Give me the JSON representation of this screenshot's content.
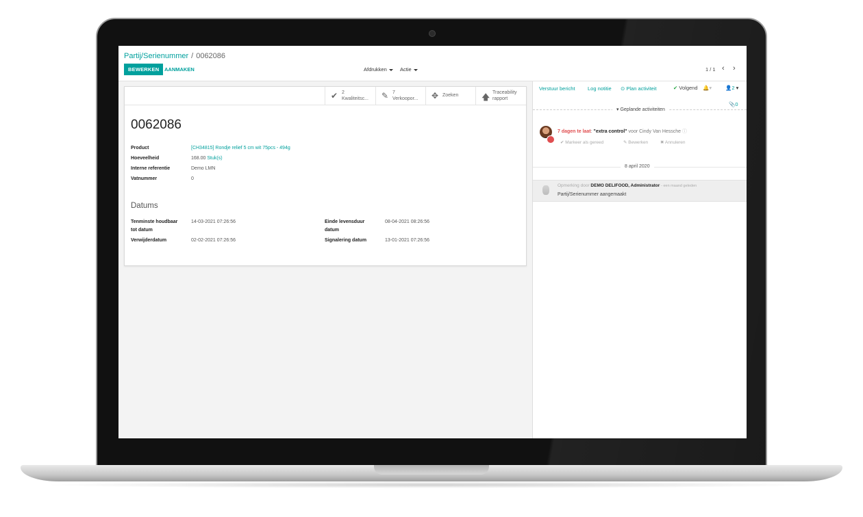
{
  "breadcrumb": {
    "parent": "Partij/Serienummer",
    "separator": "/",
    "current": "0062086"
  },
  "toolbar": {
    "edit_label": "BEWERKEN",
    "create_label": "AANMAKEN",
    "print_label": "Afdrukken",
    "action_label": "Actie"
  },
  "pager": {
    "value": "1 / 1",
    "prev": "‹",
    "next": "›"
  },
  "stat_buttons": [
    {
      "icon": "check-icon",
      "count": "2",
      "label": "Kwaliteitsc..."
    },
    {
      "icon": "edit-icon",
      "count": "7",
      "label": "Verkoopor..."
    },
    {
      "icon": "move-icon",
      "count": "",
      "label": "Zoeken"
    },
    {
      "icon": "arrow-up-icon",
      "count": "Traceability",
      "label": "rapport"
    }
  ],
  "record": {
    "title": "0062086"
  },
  "fields": [
    {
      "label": "Product",
      "value": "[CH34815] Rondje relief 5 cm wit 75pcs - 494g"
    },
    {
      "label": "Hoeveelheid",
      "value": "168.00",
      "unit": "Stuk(s)"
    },
    {
      "label": "Interne referentie",
      "value": "Demo LMN"
    },
    {
      "label": "Vatnummer",
      "value": "0"
    }
  ],
  "dates": {
    "title": "Datums",
    "items": [
      {
        "label_1": "Tenminste houdbaar",
        "label_2": "tot datum",
        "value": "14-03-2021 07:26:56"
      },
      {
        "label_1": "Verwijderdatum",
        "label_2": "",
        "value": "02-02-2021 07:26:56"
      },
      {
        "label_1": "Einde levensduur",
        "label_2": "datum",
        "value": "08-04-2021 08:26:56"
      },
      {
        "label_1": "Signalering datum",
        "label_2": "",
        "value": "13-01-2021 07:26:56"
      }
    ]
  },
  "chatter": {
    "send_message": "Verstuur bericht",
    "log_note": "Log notitie",
    "plan_activity": "Plan activiteit",
    "following": "Volgend",
    "followers_count": "2",
    "attachments_count": "0",
    "activities_header": "Geplande activiteiten",
    "activity": {
      "late": "7 dagen te laat",
      "colon": ":",
      "title": "\"extra control\"",
      "for_text": "voor Cindy Van Hessche",
      "mark_done": "Markeer als gereed",
      "edit": "Bewerken",
      "cancel": "Annuleren"
    },
    "date_separator": "8 april 2020",
    "message": {
      "prefix": "Opmerking door",
      "author": "DEMO DELIFOOD, Administrator",
      "time": "- een maand geleden",
      "body": "Partij/Serienummer aangemaakt"
    }
  },
  "colors": {
    "accent": "#00a09d",
    "late": "#e04e50"
  }
}
